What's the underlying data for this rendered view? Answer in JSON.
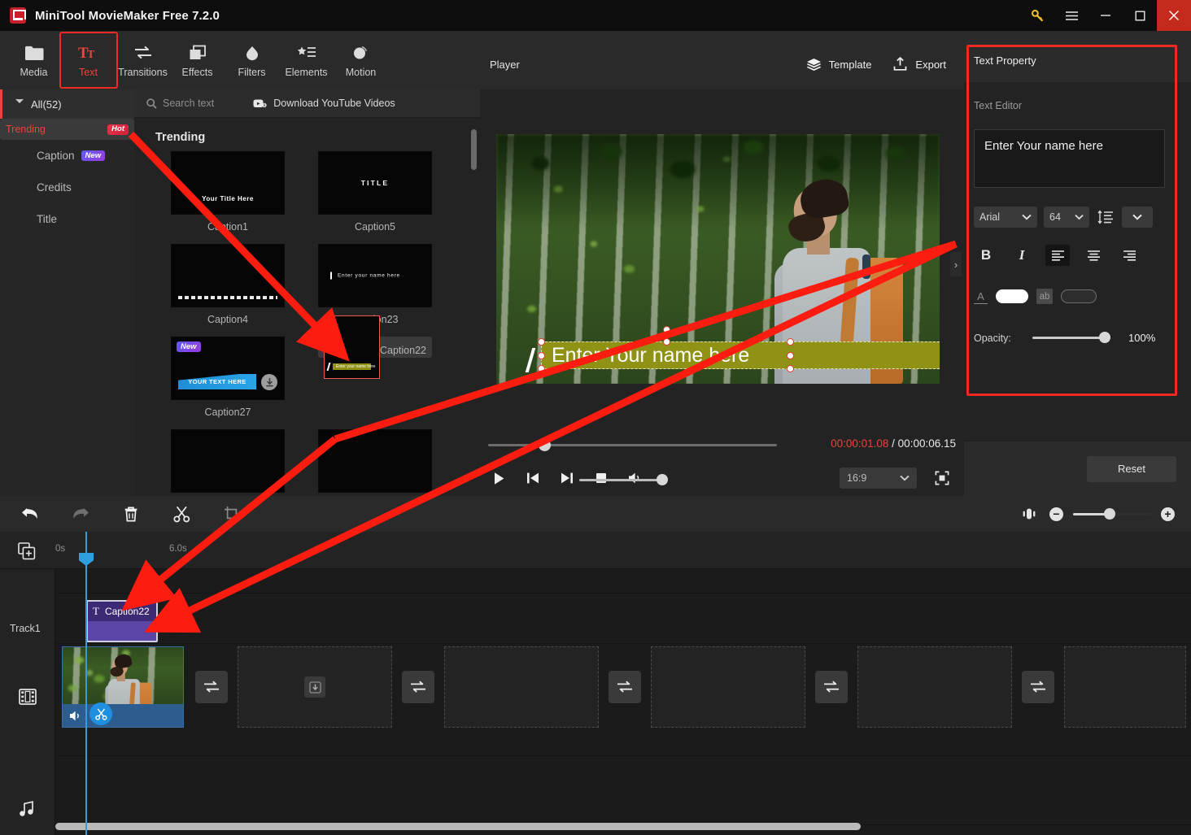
{
  "window": {
    "title": "MiniTool MovieMaker Free 7.2.0",
    "logo_icon": "app-logo-icon",
    "key_icon": "key-icon",
    "menu_icon": "hamburger-menu-icon",
    "minimize_icon": "minimize-icon",
    "maximize_icon": "maximize-icon",
    "close_icon": "close-icon",
    "close_color": "#c42b1c"
  },
  "toolbar": {
    "items": [
      {
        "label": "Media",
        "icon": "folder-icon",
        "active": false
      },
      {
        "label": "Text",
        "icon": "text-tt-icon",
        "active": true
      },
      {
        "label": "Transitions",
        "icon": "transitions-arrows-icon",
        "active": false
      },
      {
        "label": "Effects",
        "icon": "effects-squares-icon",
        "active": false
      },
      {
        "label": "Filters",
        "icon": "filters-drop-icon",
        "active": false
      },
      {
        "label": "Elements",
        "icon": "elements-star-list-icon",
        "active": false
      },
      {
        "label": "Motion",
        "icon": "motion-circle-icon",
        "active": false
      }
    ],
    "active_accent": "#e8453c"
  },
  "categories": {
    "all_label": "All(52)",
    "expand_icon": "triangle-down-icon",
    "items": [
      {
        "label": "Trending",
        "badge": "Hot",
        "badge_type": "hot",
        "selected": true
      },
      {
        "label": "Caption",
        "badge": "New",
        "badge_type": "new",
        "selected": false
      },
      {
        "label": "Credits",
        "badge": "",
        "badge_type": "",
        "selected": false
      },
      {
        "label": "Title",
        "badge": "",
        "badge_type": "",
        "selected": false
      }
    ]
  },
  "browser": {
    "search": {
      "placeholder": "Search text",
      "icon": "search-icon"
    },
    "youtube": {
      "label": "Download YouTube Videos",
      "icon": "youtube-download-icon"
    },
    "section_title": "Trending",
    "templates": [
      {
        "name": "Caption1",
        "preview_text": "Your Title Here",
        "style": "title-bottom",
        "badge": "",
        "selected": false
      },
      {
        "name": "Caption5",
        "preview_text": "TITLE",
        "style": "title-center",
        "badge": "",
        "selected": false
      },
      {
        "name": "Caption4",
        "preview_text": "",
        "style": "tiny-bar",
        "badge": "",
        "selected": false
      },
      {
        "name": "Caption23",
        "preview_text": "Enter your name here",
        "style": "name-cursor",
        "badge": "",
        "selected": false
      },
      {
        "name": "Caption27",
        "preview_text": "YOUR TEXT HERE",
        "style": "blue-banner",
        "badge": "New",
        "selected": false
      },
      {
        "name": "Caption22",
        "preview_text": "Enter your name here",
        "style": "olive-bar",
        "badge": "",
        "selected": true
      }
    ]
  },
  "player": {
    "label": "Player",
    "template_button": {
      "label": "Template",
      "icon": "layers-icon"
    },
    "export_button": {
      "label": "Export",
      "icon": "export-upload-icon"
    },
    "overlay_caption": "Enter Your name here",
    "overlay_bar_color": "#8f9214",
    "current_time": "00:00:01.08",
    "total_time": "/ 00:00:06.15",
    "current_time_color": "#e8453c",
    "controls": [
      {
        "name": "play-button",
        "icon": "play-icon"
      },
      {
        "name": "previous-frame-button",
        "icon": "skip-previous-icon"
      },
      {
        "name": "next-frame-button",
        "icon": "skip-next-icon"
      },
      {
        "name": "stop-button",
        "icon": "stop-square-icon"
      },
      {
        "name": "volume-button",
        "icon": "speaker-icon"
      }
    ],
    "aspect_ratio": "16:9",
    "fullscreen_icon": "fullscreen-icon"
  },
  "text_property": {
    "panel_title": "Text Property",
    "highlight_color": "#ee2a22",
    "section_label": "Text Editor",
    "editor_value": "Enter Your name here",
    "font_family": "Arial",
    "font_size": "64",
    "line_spacing_icon": "line-spacing-icon",
    "more_icon": "chevron-down-icon",
    "bold_label": "B",
    "italic_label": "I",
    "align_left_icon": "align-left-icon",
    "align_center_icon": "align-center-icon",
    "align_right_icon": "align-right-icon",
    "active_align": "left",
    "text_color_label": "A",
    "text_color": "#ffffff",
    "highlight_label": "ab",
    "highlight_swatch_color": "#2d2d2d",
    "opacity_label": "Opacity:",
    "opacity_value": "100%",
    "reset_label": "Reset"
  },
  "timeline_toolbar": {
    "buttons": [
      {
        "name": "undo-button",
        "icon": "undo-arrow-icon",
        "enabled": true
      },
      {
        "name": "redo-button",
        "icon": "redo-arrow-icon",
        "enabled": false
      },
      {
        "name": "delete-button",
        "icon": "trash-icon",
        "enabled": true
      },
      {
        "name": "split-button",
        "icon": "scissors-icon",
        "enabled": true
      },
      {
        "name": "crop-button",
        "icon": "crop-icon",
        "enabled": true
      }
    ],
    "fit_icon": "fit-to-window-icon",
    "zoom_out_label": "−",
    "zoom_in_label": "+"
  },
  "timeline": {
    "add_track_icon": "add-track-icon",
    "ruler_ticks": [
      "0s",
      "6.0s"
    ],
    "tracks": [
      {
        "label": "Track1",
        "icon": "",
        "type": "text"
      },
      {
        "label": "",
        "icon": "film-strip-icon",
        "type": "video"
      },
      {
        "label": "",
        "icon": "music-note-icon",
        "type": "audio"
      }
    ],
    "text_clip": {
      "label": "Caption22",
      "icon": "text-t-icon",
      "color": "#5b46a8"
    },
    "video_clip": {
      "speaker_icon": "speaker-icon",
      "cut_icon": "scissors-badge-icon"
    },
    "empty_slots": 4,
    "transition_buttons": 4,
    "transition_icon": "transition-swap-icon",
    "slot_icon": "download-into-slot-icon",
    "playhead_color": "#2f9fe0"
  },
  "annotations": {
    "arrow_color": "#fc1c10",
    "count": 3
  }
}
